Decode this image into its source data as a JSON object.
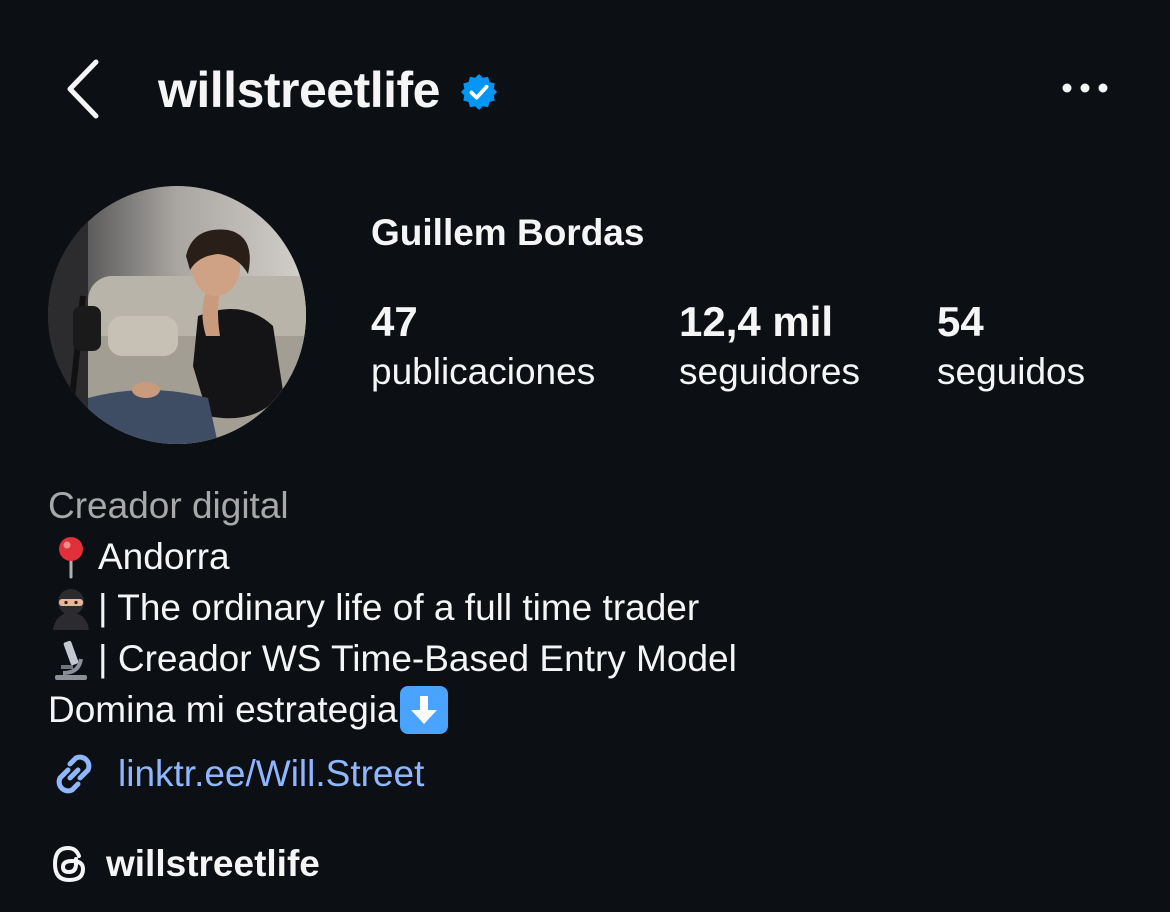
{
  "header": {
    "username": "willstreetlife",
    "back_icon": "chevron-left-icon",
    "verified_icon": "verified-badge-icon",
    "more_icon": "more-horizontal-icon"
  },
  "profile": {
    "display_name": "Guillem Bordas",
    "avatar": "profile-photo",
    "stats": [
      {
        "value": "47",
        "label": "publicaciones"
      },
      {
        "value": "12,4 mil",
        "label": "seguidores"
      },
      {
        "value": "54",
        "label": "seguidos"
      }
    ]
  },
  "bio": {
    "category": "Creador digital",
    "location": "Andorra",
    "line1": "| The ordinary life of a full time trader",
    "line2": "| Creador WS Time-Based Entry Model",
    "line3": "Domina mi estrategia",
    "emojis": [
      "pushpin",
      "ninja",
      "microscope",
      "down-arrow-button"
    ]
  },
  "link": {
    "icon": "link-icon",
    "text": "linktr.ee/Will.Street"
  },
  "threads": {
    "icon": "threads-icon",
    "handle": "willstreetlife"
  },
  "colors": {
    "background": "#0c1014",
    "text": "#f5f5f5",
    "muted": "#a8a8a8",
    "link": "#8fb7ff",
    "verified": "#0095f6"
  }
}
